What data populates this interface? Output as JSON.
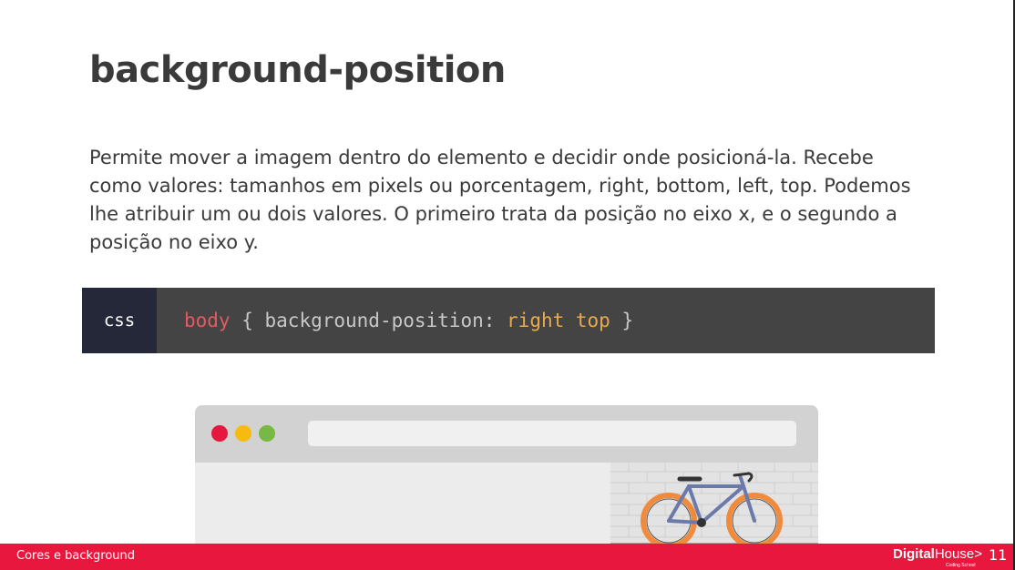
{
  "slide": {
    "title": "background-position",
    "description": "Permite mover a imagem dentro do elemento e decidir onde posicioná-la. Recebe como valores: tamanhos em pixels ou porcentagem, right, bottom, left, top. Podemos lhe atribuir um ou dois valores. O primeiro trata da posição no eixo x, e o segundo a posição no eixo y.",
    "code": {
      "language": "css",
      "selector": "body",
      "open_brace": " { ",
      "property": "background-position: ",
      "value": "right top",
      "close_brace": " }"
    }
  },
  "browser_mockup": {
    "traffic_lights": [
      "#e6173f",
      "#f7bb10",
      "#78b844"
    ],
    "image": "bicycle-against-white-brick-wall"
  },
  "footer": {
    "section_label": "Cores e background",
    "logo_bold": "Digital",
    "logo_light": "House>",
    "logo_sub": "Coding School",
    "page_number": "11",
    "color": "#e8173d"
  }
}
